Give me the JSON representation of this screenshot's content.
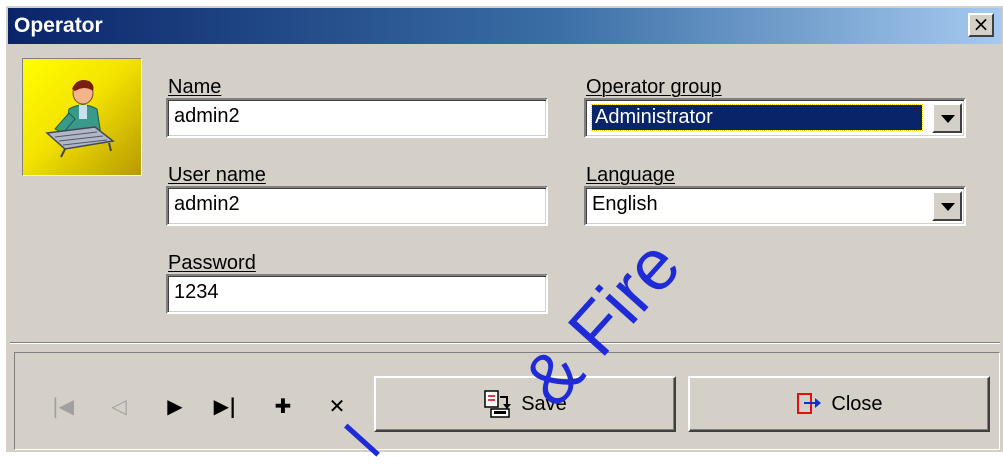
{
  "window": {
    "title": "Operator",
    "close_glyph": "×"
  },
  "avatar": {
    "icon": "operator-at-keyboard"
  },
  "fields": {
    "name": {
      "label": "Name",
      "value": "admin2"
    },
    "user_name": {
      "label": "User name",
      "value": "admin2"
    },
    "password": {
      "label": "Password",
      "value": "1234"
    },
    "operator_group": {
      "label": "Operator group",
      "value": "Administrator"
    },
    "language": {
      "label": "Language",
      "value": "English"
    }
  },
  "navigation": [
    {
      "name": "first-record",
      "glyph": "|◀",
      "enabled": false
    },
    {
      "name": "previous-record",
      "glyph": "◁",
      "enabled": false
    },
    {
      "name": "next-record",
      "glyph": "▶",
      "enabled": true
    },
    {
      "name": "last-record",
      "glyph": "▶|",
      "enabled": true
    },
    {
      "name": "add-record",
      "glyph": "✚",
      "enabled": true
    },
    {
      "name": "delete-record",
      "glyph": "✕",
      "enabled": true
    }
  ],
  "buttons": {
    "save": {
      "label": "Save",
      "icon": "save-icon"
    },
    "close": {
      "label": "Close",
      "icon": "exit-icon"
    }
  },
  "watermark": {
    "text_main": "& Fire",
    "text_fragment": "l",
    "color": "#1f2bd6"
  },
  "colors": {
    "titlebar_start": "#0a246a",
    "titlebar_end": "#a6caf0",
    "face": "#d4d0c8",
    "selection": "#0a246a"
  }
}
